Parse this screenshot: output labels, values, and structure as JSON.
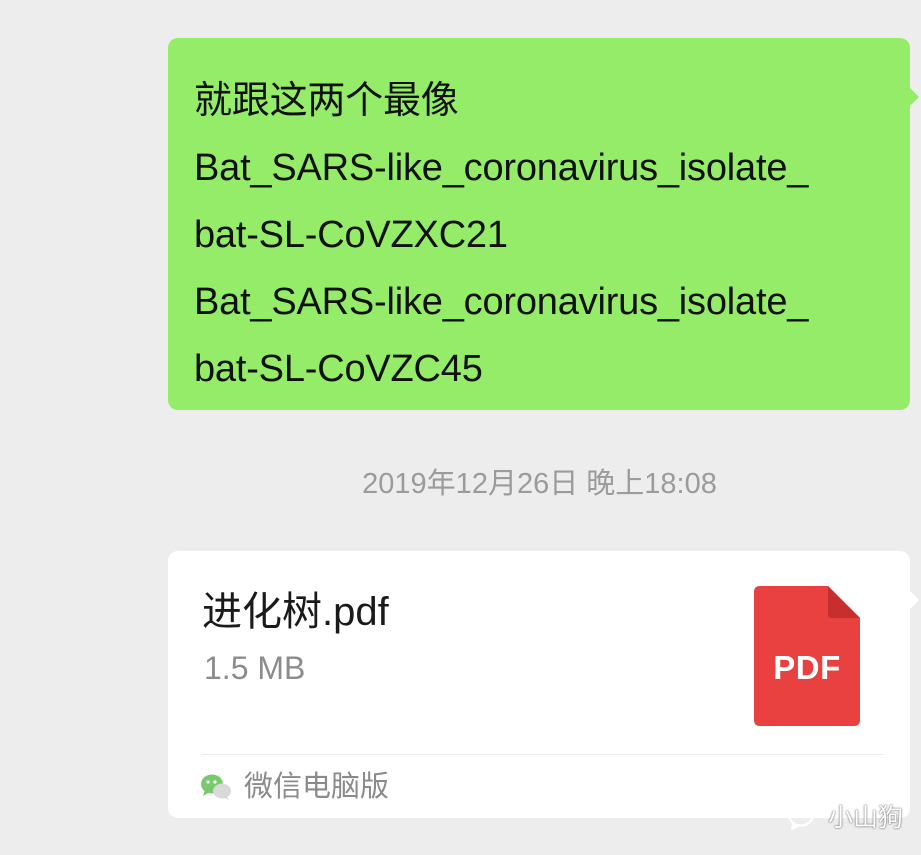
{
  "messages": {
    "text_bubble": {
      "lines": [
        "就跟这两个最像",
        "Bat_SARS-like_coronavirus_isolate_",
        "bat-SL-CoVZXC21",
        "Bat_SARS-like_coronavirus_isolate_",
        "bat-SL-CoVZC45"
      ],
      "bubble_color": "#95ec69"
    },
    "timestamp": "2019年12月26日 晚上18:08",
    "file_card": {
      "file_name": "进化树.pdf",
      "file_size": "1.5 MB",
      "file_icon": "pdf-file-icon",
      "file_icon_label": "PDF",
      "file_icon_color": "#e94040",
      "source_icon": "wechat-icon",
      "source_label": "微信电脑版"
    }
  },
  "watermark": {
    "icon": "wechat-official-account-icon",
    "text": "小山狗"
  }
}
